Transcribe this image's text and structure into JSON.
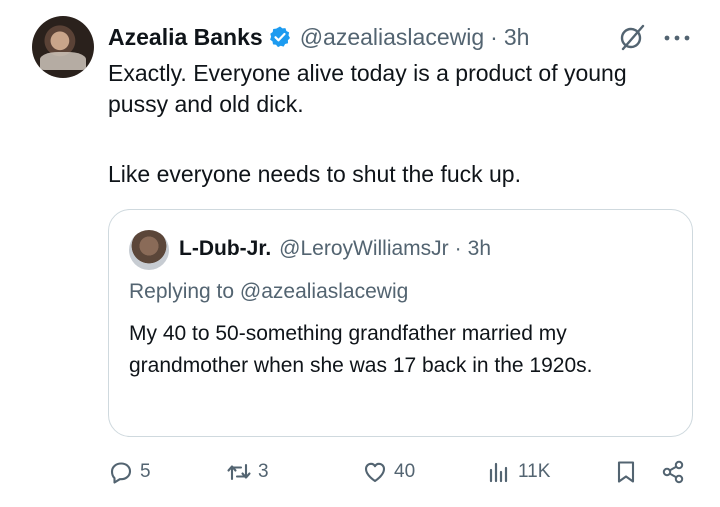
{
  "tweet": {
    "display_name": "Azealia Banks",
    "handle": "@azealiaslacewig",
    "separator": "·",
    "time": "3h",
    "line1": "Exactly. Everyone alive today is a product of young",
    "line2": "pussy and old dick.",
    "line3": "Like everyone needs to shut the fuck up."
  },
  "quote": {
    "display_name": "L-Dub-Jr.",
    "handle": "@LeroyWilliamsJr",
    "separator": "·",
    "time": "3h",
    "replying_to": "Replying to @azealiaslacewig",
    "text": "My 40 to 50-something grandfather married my grandmother when she was 17 back in the 1920s."
  },
  "actions": {
    "replies": "5",
    "reposts": "3",
    "likes": "40",
    "views": "11K"
  },
  "colors": {
    "verified": "#1d9bf0",
    "muted": "#536471",
    "border": "#cfd9de"
  },
  "icons": [
    "verified-badge-icon",
    "grok-icon",
    "more-icon",
    "reply-icon",
    "repost-icon",
    "like-icon",
    "views-icon",
    "bookmark-icon",
    "share-icon"
  ]
}
